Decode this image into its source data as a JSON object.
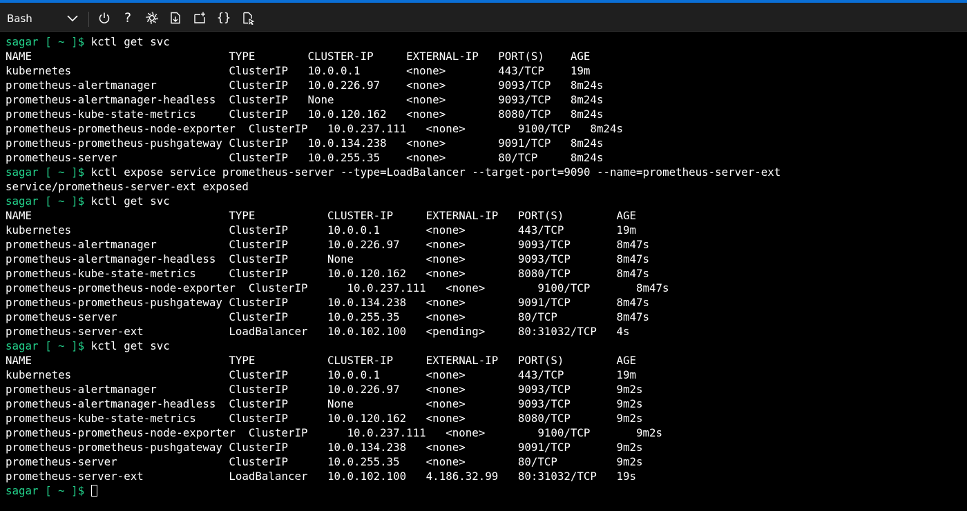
{
  "colors": {
    "accent": "#0a6fd6",
    "toolbar_bg": "#1f1f1f",
    "terminal_bg": "#000000",
    "prompt": "#23d18b",
    "text": "#ffffff"
  },
  "toolbar": {
    "shell": "Bash",
    "icons": [
      "chevron-down-icon",
      "power-icon",
      "help-icon",
      "settings-icon",
      "upload-download-icon",
      "new-session-icon",
      "editor-icon",
      "web-preview-icon"
    ],
    "help_glyph": "?",
    "editor_glyph": "{}"
  },
  "terminal": {
    "lines": [
      {
        "prompt": "sagar [ ~ ]$",
        "text": " kctl get svc"
      },
      {
        "prompt": "",
        "text": "NAME                              TYPE        CLUSTER-IP     EXTERNAL-IP   PORT(S)    AGE"
      },
      {
        "prompt": "",
        "text": "kubernetes                        ClusterIP   10.0.0.1       <none>        443/TCP    19m"
      },
      {
        "prompt": "",
        "text": "prometheus-alertmanager           ClusterIP   10.0.226.97    <none>        9093/TCP   8m24s"
      },
      {
        "prompt": "",
        "text": "prometheus-alertmanager-headless  ClusterIP   None           <none>        9093/TCP   8m24s"
      },
      {
        "prompt": "",
        "text": "prometheus-kube-state-metrics     ClusterIP   10.0.120.162   <none>        8080/TCP   8m24s"
      },
      {
        "prompt": "",
        "text": "prometheus-prometheus-node-exporter  ClusterIP   10.0.237.111   <none>        9100/TCP   8m24s"
      },
      {
        "prompt": "",
        "text": "prometheus-prometheus-pushgateway ClusterIP   10.0.134.238   <none>        9091/TCP   8m24s"
      },
      {
        "prompt": "",
        "text": "prometheus-server                 ClusterIP   10.0.255.35    <none>        80/TCP     8m24s"
      },
      {
        "prompt": "sagar [ ~ ]$",
        "text": " kctl expose service prometheus-server --type=LoadBalancer --target-port=9090 --name=prometheus-server-ext"
      },
      {
        "prompt": "",
        "text": "service/prometheus-server-ext exposed"
      },
      {
        "prompt": "sagar [ ~ ]$",
        "text": " kctl get svc"
      },
      {
        "prompt": "",
        "text": "NAME                              TYPE           CLUSTER-IP     EXTERNAL-IP   PORT(S)        AGE"
      },
      {
        "prompt": "",
        "text": "kubernetes                        ClusterIP      10.0.0.1       <none>        443/TCP        19m"
      },
      {
        "prompt": "",
        "text": "prometheus-alertmanager           ClusterIP      10.0.226.97    <none>        9093/TCP       8m47s"
      },
      {
        "prompt": "",
        "text": "prometheus-alertmanager-headless  ClusterIP      None           <none>        9093/TCP       8m47s"
      },
      {
        "prompt": "",
        "text": "prometheus-kube-state-metrics     ClusterIP      10.0.120.162   <none>        8080/TCP       8m47s"
      },
      {
        "prompt": "",
        "text": "prometheus-prometheus-node-exporter  ClusterIP      10.0.237.111   <none>        9100/TCP       8m47s"
      },
      {
        "prompt": "",
        "text": "prometheus-prometheus-pushgateway ClusterIP      10.0.134.238   <none>        9091/TCP       8m47s"
      },
      {
        "prompt": "",
        "text": "prometheus-server                 ClusterIP      10.0.255.35    <none>        80/TCP         8m47s"
      },
      {
        "prompt": "",
        "text": "prometheus-server-ext             LoadBalancer   10.0.102.100   <pending>     80:31032/TCP   4s"
      },
      {
        "prompt": "sagar [ ~ ]$",
        "text": " kctl get svc"
      },
      {
        "prompt": "",
        "text": "NAME                              TYPE           CLUSTER-IP     EXTERNAL-IP   PORT(S)        AGE"
      },
      {
        "prompt": "",
        "text": "kubernetes                        ClusterIP      10.0.0.1       <none>        443/TCP        19m"
      },
      {
        "prompt": "",
        "text": "prometheus-alertmanager           ClusterIP      10.0.226.97    <none>        9093/TCP       9m2s"
      },
      {
        "prompt": "",
        "text": "prometheus-alertmanager-headless  ClusterIP      None           <none>        9093/TCP       9m2s"
      },
      {
        "prompt": "",
        "text": "prometheus-kube-state-metrics     ClusterIP      10.0.120.162   <none>        8080/TCP       9m2s"
      },
      {
        "prompt": "",
        "text": "prometheus-prometheus-node-exporter  ClusterIP      10.0.237.111   <none>        9100/TCP       9m2s"
      },
      {
        "prompt": "",
        "text": "prometheus-prometheus-pushgateway ClusterIP      10.0.134.238   <none>        9091/TCP       9m2s"
      },
      {
        "prompt": "",
        "text": "prometheus-server                 ClusterIP      10.0.255.35    <none>        80/TCP         9m2s"
      },
      {
        "prompt": "",
        "text": "prometheus-server-ext             LoadBalancer   10.0.102.100   4.186.32.99   80:31032/TCP   19s"
      },
      {
        "prompt": "sagar [ ~ ]$",
        "text": " ",
        "cursor": true
      }
    ]
  }
}
